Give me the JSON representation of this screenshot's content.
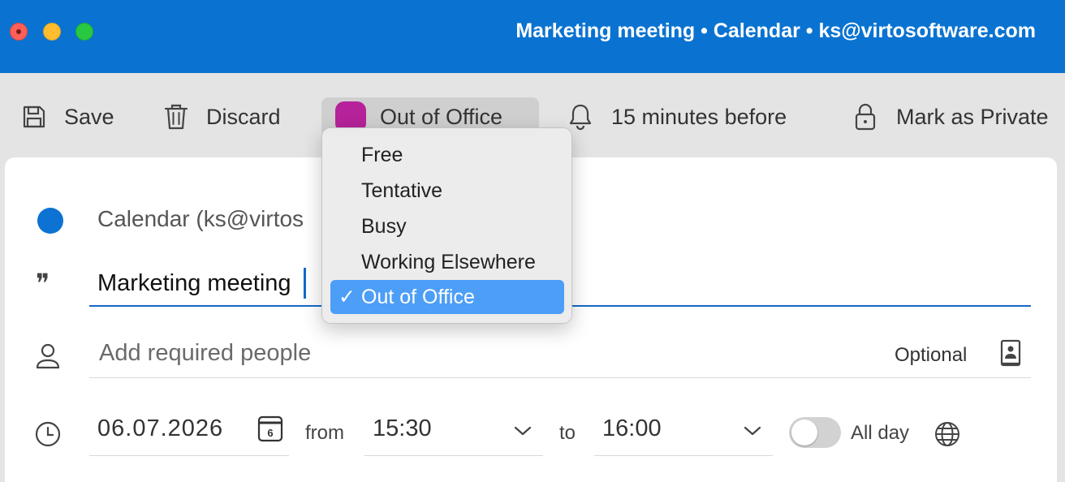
{
  "window": {
    "title": "Marketing meeting • Calendar • ks@virtosoftware.com"
  },
  "toolbar": {
    "save_label": "Save",
    "discard_label": "Discard",
    "show_as_label": "Out of Office",
    "reminder_label": "15 minutes before",
    "private_label": "Mark as Private"
  },
  "show_as_menu": {
    "items": [
      {
        "label": "Free"
      },
      {
        "label": "Tentative"
      },
      {
        "label": "Busy"
      },
      {
        "label": "Working Elsewhere"
      },
      {
        "label": "Out of Office"
      }
    ],
    "selected_index": 4,
    "check_glyph": "✓"
  },
  "event": {
    "calendar_name": "Calendar (ks@virtos",
    "title_value": "Marketing meeting",
    "people_placeholder": "Add required people",
    "optional_label": "Optional",
    "date": "06.07.2026",
    "date_icon_day": "6",
    "from_label": "from",
    "start_time": "15:30",
    "to_label": "to",
    "end_time": "16:00",
    "all_day_label": "All day",
    "all_day_on": false
  },
  "colors": {
    "titlebar": "#0a73d1",
    "status_out_of_office": "#b5229a",
    "calendar_dot": "#0c72d3",
    "selection": "#4d9ef7"
  },
  "icons": {
    "save": "save-icon",
    "discard": "trash-icon",
    "reminder": "bell-icon",
    "private": "lock-icon",
    "title": "quote-icon",
    "people": "person-icon",
    "address_book": "address-book-icon",
    "time": "clock-icon",
    "date": "calendar-icon",
    "timezone": "globe-icon"
  }
}
